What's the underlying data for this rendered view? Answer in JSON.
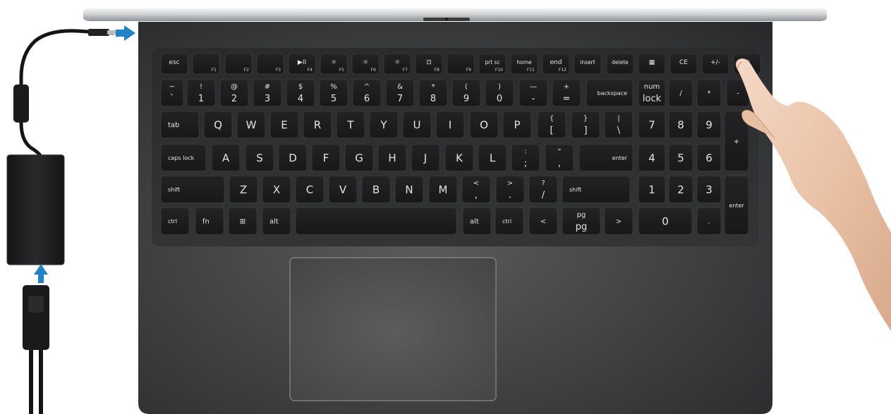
{
  "keyboard": {
    "rows": [
      [
        {
          "top": "esc",
          "bottom": ""
        },
        {
          "top": "",
          "bottom": "F1",
          "icon": "mute"
        },
        {
          "top": "",
          "bottom": "F2",
          "icon": "vol-down"
        },
        {
          "top": "",
          "bottom": "F3",
          "icon": "vol-up"
        },
        {
          "top": "▶II",
          "bottom": "F4"
        },
        {
          "top": "☼",
          "bottom": "F5"
        },
        {
          "top": "☼",
          "bottom": "F6"
        },
        {
          "top": "☼",
          "bottom": "F7"
        },
        {
          "top": "⊡",
          "bottom": "F8"
        },
        {
          "top": "",
          "bottom": "F9"
        },
        {
          "top": "prt sc",
          "bottom": "F10"
        },
        {
          "top": "home",
          "bottom": "F11"
        },
        {
          "top": "end",
          "bottom": "F12"
        },
        {
          "top": "insert",
          "bottom": ""
        },
        {
          "top": "delete",
          "bottom": ""
        },
        {
          "top": "▦",
          "bottom": ""
        },
        {
          "top": "CE",
          "bottom": ""
        },
        {
          "top": "+/-",
          "bottom": ""
        },
        {
          "top": "⏻",
          "bottom": ""
        }
      ],
      [
        {
          "top": "~",
          "bottom": "`"
        },
        {
          "top": "!",
          "bottom": "1"
        },
        {
          "top": "@",
          "bottom": "2"
        },
        {
          "top": "#",
          "bottom": "3"
        },
        {
          "top": "$",
          "bottom": "4"
        },
        {
          "top": "%",
          "bottom": "5"
        },
        {
          "top": "^",
          "bottom": "6"
        },
        {
          "top": "&",
          "bottom": "7"
        },
        {
          "top": "*",
          "bottom": "8"
        },
        {
          "top": "(",
          "bottom": "9"
        },
        {
          "top": ")",
          "bottom": "0"
        },
        {
          "top": "—",
          "bottom": "-"
        },
        {
          "top": "+",
          "bottom": "="
        },
        {
          "top": "backspace",
          "bottom": ""
        },
        {
          "top": "num",
          "bottom": "lock"
        },
        {
          "top": "/",
          "bottom": ""
        },
        {
          "top": "*",
          "bottom": ""
        },
        {
          "top": "-",
          "bottom": ""
        }
      ],
      [
        {
          "top": "tab",
          "bottom": ""
        },
        {
          "top": "Q",
          "bottom": ""
        },
        {
          "top": "W",
          "bottom": ""
        },
        {
          "top": "E",
          "bottom": ""
        },
        {
          "top": "R",
          "bottom": ""
        },
        {
          "top": "T",
          "bottom": ""
        },
        {
          "top": "Y",
          "bottom": ""
        },
        {
          "top": "U",
          "bottom": ""
        },
        {
          "top": "I",
          "bottom": ""
        },
        {
          "top": "O",
          "bottom": ""
        },
        {
          "top": "P",
          "bottom": ""
        },
        {
          "top": "{",
          "bottom": "["
        },
        {
          "top": "}",
          "bottom": "]"
        },
        {
          "top": "|",
          "bottom": "\\"
        },
        {
          "top": "7",
          "bottom": ""
        },
        {
          "top": "8",
          "bottom": ""
        },
        {
          "top": "9",
          "bottom": ""
        },
        {
          "top": "+",
          "bottom": ""
        }
      ],
      [
        {
          "top": "caps lock",
          "bottom": ""
        },
        {
          "top": "A",
          "bottom": ""
        },
        {
          "top": "S",
          "bottom": ""
        },
        {
          "top": "D",
          "bottom": ""
        },
        {
          "top": "F",
          "bottom": ""
        },
        {
          "top": "G",
          "bottom": ""
        },
        {
          "top": "H",
          "bottom": ""
        },
        {
          "top": "J",
          "bottom": ""
        },
        {
          "top": "K",
          "bottom": ""
        },
        {
          "top": "L",
          "bottom": ""
        },
        {
          "top": ":",
          "bottom": ";"
        },
        {
          "top": "\"",
          "bottom": ","
        },
        {
          "top": "enter",
          "bottom": ""
        },
        {
          "top": "4",
          "bottom": ""
        },
        {
          "top": "5",
          "bottom": ""
        },
        {
          "top": "6",
          "bottom": ""
        }
      ],
      [
        {
          "top": "shift",
          "bottom": ""
        },
        {
          "top": "Z",
          "bottom": ""
        },
        {
          "top": "X",
          "bottom": ""
        },
        {
          "top": "C",
          "bottom": ""
        },
        {
          "top": "V",
          "bottom": ""
        },
        {
          "top": "B",
          "bottom": ""
        },
        {
          "top": "N",
          "bottom": ""
        },
        {
          "top": "M",
          "bottom": ""
        },
        {
          "top": "<",
          "bottom": ","
        },
        {
          "top": ">",
          "bottom": "."
        },
        {
          "top": "?",
          "bottom": "/"
        },
        {
          "top": "shift",
          "bottom": ""
        },
        {
          "top": "1",
          "bottom": ""
        },
        {
          "top": "2",
          "bottom": ""
        },
        {
          "top": "3",
          "bottom": ""
        },
        {
          "top": "enter",
          "bottom": ""
        }
      ],
      [
        {
          "top": "ctrl",
          "bottom": ""
        },
        {
          "top": "fn",
          "bottom": ""
        },
        {
          "top": "⊞",
          "bottom": ""
        },
        {
          "top": "alt",
          "bottom": ""
        },
        {
          "top": "",
          "bottom": ""
        },
        {
          "top": "alt",
          "bottom": ""
        },
        {
          "top": "ctrl",
          "bottom": ""
        },
        {
          "top": "<",
          "bottom": ""
        },
        {
          "top": "pg",
          "bottom": "pg"
        },
        {
          "top": ">",
          "bottom": ""
        },
        {
          "top": "0",
          "bottom": ""
        },
        {
          "top": ".",
          "bottom": ""
        }
      ]
    ]
  },
  "icons": {
    "adapter_arrow": "arrow-right-icon",
    "cord_arrow": "arrow-up-icon",
    "power_touch": "hand-icon"
  },
  "colors": {
    "arrow_blue": "#1f83c8",
    "chassis": "#2f3032",
    "key": "#1d1d1f",
    "lid_silver": "#d4d6d8"
  }
}
